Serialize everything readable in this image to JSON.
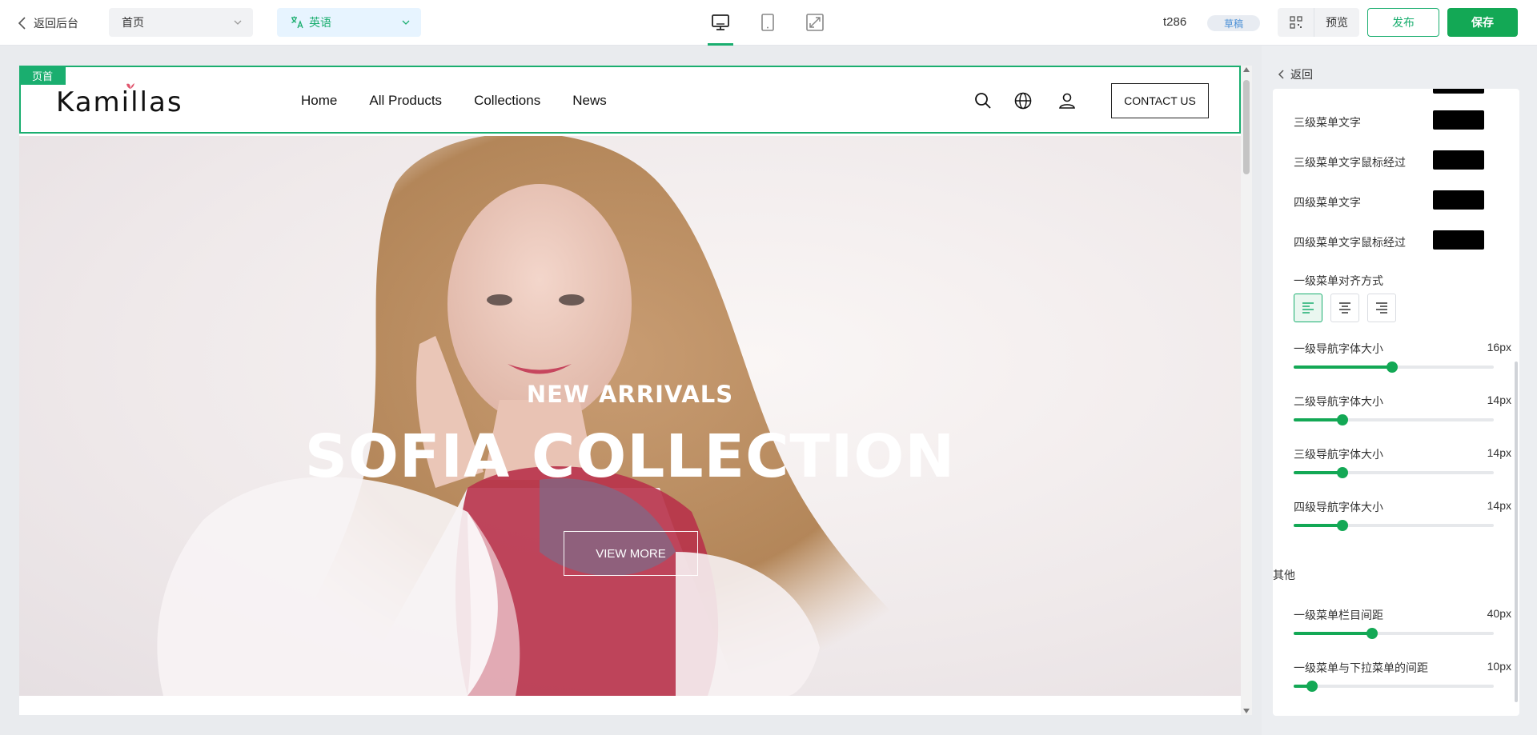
{
  "topbar": {
    "back_label": "返回后台",
    "page_select": "首页",
    "language_select": "英语",
    "devices": [
      "desktop-icon",
      "tablet-icon",
      "fullscreen-icon"
    ],
    "user": "t286",
    "status_badge": "草稿",
    "preview_label": "预览",
    "publish_label": "发布",
    "save_label": "保存",
    "accent_color": "#13a855"
  },
  "canvas": {
    "section_tag": "页首",
    "logo": "Kamillas",
    "nav": [
      "Home",
      "All Products",
      "Collections",
      "News"
    ],
    "header_icons": [
      "search-icon",
      "globe-icon",
      "user-icon"
    ],
    "contact_label": "CONTACT US",
    "hero": {
      "subtitle": "NEW ARRIVALS",
      "title": "SOFIA COLLECTION",
      "button": "VIEW MORE"
    }
  },
  "panel": {
    "back_label": "返回",
    "color_settings": [
      {
        "label": "三级菜单文字",
        "color": "#000000"
      },
      {
        "label": "三级菜单文字鼠标经过",
        "color": "#000000"
      },
      {
        "label": "四级菜单文字",
        "color": "#000000"
      },
      {
        "label": "四级菜单文字鼠标经过",
        "color": "#000000"
      }
    ],
    "align_label": "一级菜单对齐方式",
    "align_options": [
      "align-left-icon",
      "align-center-icon",
      "align-right-icon"
    ],
    "align_selected": "left",
    "font_sliders": [
      {
        "label": "一级导航字体大小",
        "value": "16px",
        "fraction": 0.49
      },
      {
        "label": "二级导航字体大小",
        "value": "14px",
        "fraction": 0.245
      },
      {
        "label": "三级导航字体大小",
        "value": "14px",
        "fraction": 0.245
      },
      {
        "label": "四级导航字体大小",
        "value": "14px",
        "fraction": 0.245
      }
    ],
    "other_section": "其他",
    "other_sliders": [
      {
        "label": "一级菜单栏目间距",
        "value": "40px",
        "fraction": 0.39
      },
      {
        "label": "一级菜单与下拉菜单的间距",
        "value": "10px",
        "fraction": 0.09
      }
    ]
  }
}
